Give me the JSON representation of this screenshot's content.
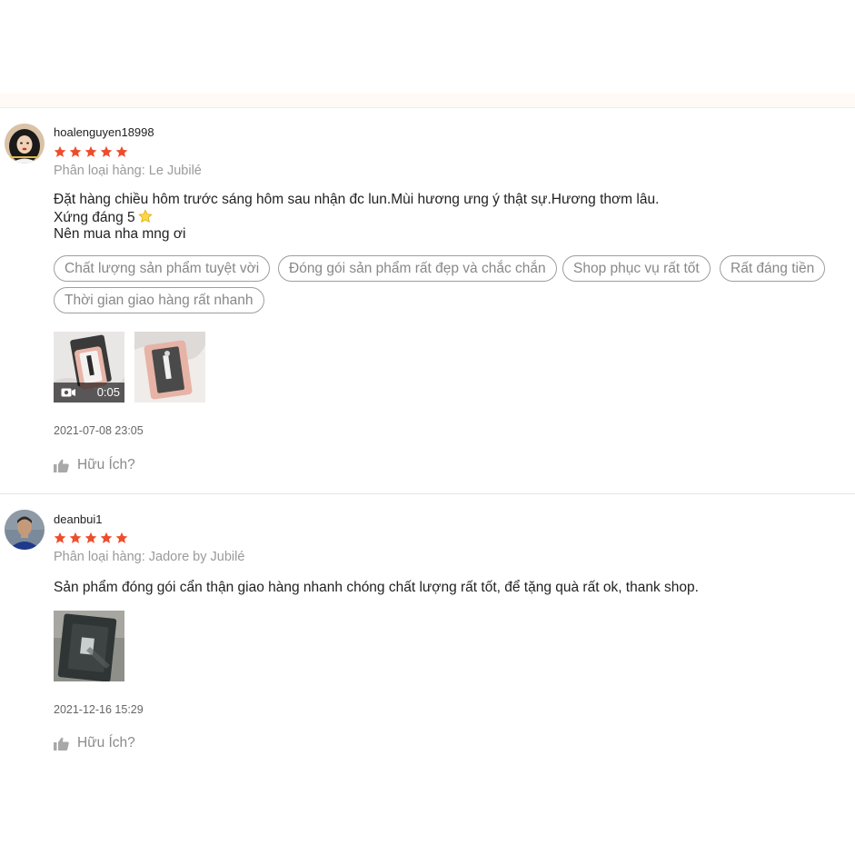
{
  "colors": {
    "star": "#ee4d2d",
    "tag_border": "#9e9e9e",
    "muted_text": "#9a9a9a"
  },
  "reviews": [
    {
      "username": "hoalenguyen18998",
      "rating": 5,
      "variant": "Phân loại hàng: Le Jubilé",
      "comment_lines": [
        "Đặt hàng chiều hôm trước sáng hôm sau nhận đc lun.Mùi hương ưng ý thật sự.Hương thơm lâu.",
        "Xứng đáng 5",
        "Nên mua nha mng ơi"
      ],
      "comment_inline_icon": "star-emoji-icon",
      "tags": [
        "Chất lượng sản phẩm tuyệt vời",
        "Đóng gói sản phẩm rất đẹp và chắc chắn",
        "Shop phục vụ rất tốt",
        "Rất đáng tiền",
        "Thời gian giao hàng rất nhanh"
      ],
      "media": [
        {
          "type": "video",
          "duration": "0:05",
          "icon": "video-camera-icon"
        },
        {
          "type": "image"
        }
      ],
      "date": "2021-07-08 23:05",
      "helpful_label": "Hữu Ích?",
      "helpful_icon": "thumbs-up-icon"
    },
    {
      "username": "deanbui1",
      "rating": 5,
      "variant": "Phân loại hàng: Jadore by Jubilé",
      "comment_lines": [
        "Sản phẩm đóng gói cẩn thận giao hàng nhanh chóng chất lượng rất tốt, để tặng quà rất ok, thank shop."
      ],
      "media": [
        {
          "type": "image"
        }
      ],
      "date": "2021-12-16 15:29",
      "helpful_label": "Hữu Ích?",
      "helpful_icon": "thumbs-up-icon"
    }
  ]
}
